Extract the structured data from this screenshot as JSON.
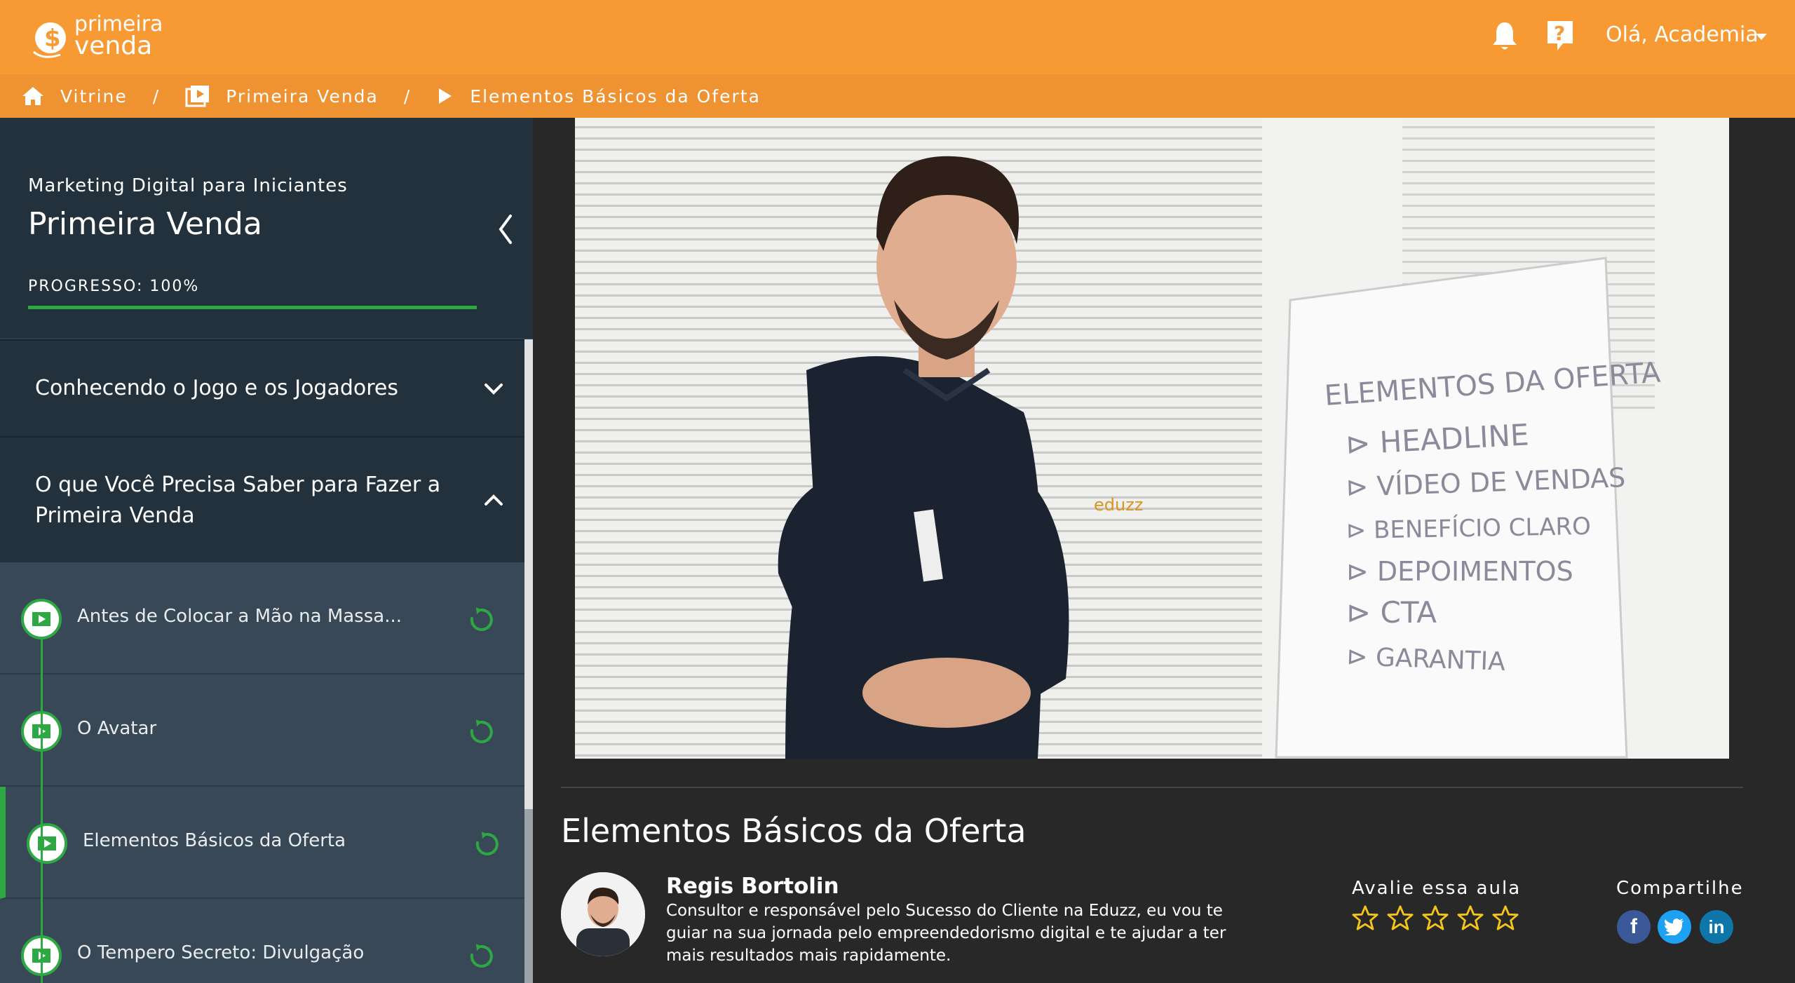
{
  "app": {
    "logo": "primeira venda",
    "logo_line1": "primeira",
    "logo_line2": "venda",
    "greeting": "Olá, Academia"
  },
  "breadcrumb": {
    "items": [
      {
        "label": "Vitrine",
        "icon": "home-icon"
      },
      {
        "label": "Primeira Venda",
        "icon": "video-library-icon"
      },
      {
        "label": "Elementos Básicos da Oferta",
        "icon": "play-icon"
      }
    ],
    "separator": "/"
  },
  "sidebar": {
    "course_subtitle": "Marketing Digital para Iniciantes",
    "course_title": "Primeira Venda",
    "progress_label": "PROGRESSO: 100%",
    "progress_value": 1.0,
    "modules": [
      {
        "title": "Conhecendo o Jogo e os Jogadores",
        "expanded": false
      },
      {
        "title_line1": "O que Você Precisa Saber para Fazer a",
        "title_line2": "Primeira Venda",
        "expanded": true
      }
    ],
    "lessons": [
      {
        "title": "Antes de Colocar a Mão na Massa...",
        "active": false
      },
      {
        "title": "O Avatar",
        "active": false
      },
      {
        "title": "Elementos Básicos da Oferta",
        "active": true
      },
      {
        "title": "O Tempero Secreto: Divulgação",
        "active": false
      }
    ]
  },
  "main": {
    "lesson_title": "Elementos Básicos da Oferta",
    "author_name": "Regis Bortolin",
    "author_bio": "Consultor e responsável pelo Sucesso do Cliente na Eduzz, eu vou te guiar na sua jornada pelo empreendedorismo digital e te ajudar a ter mais resultados mais rapidamente.",
    "rate_label": "Avalie essa aula",
    "rating": 0,
    "rating_max": 5,
    "share_label": "Compartilhe",
    "social": [
      "facebook-icon",
      "twitter-icon",
      "linkedin-icon"
    ]
  },
  "video": {
    "shirt_logo": "eduzz",
    "flipchart_title": "ELEMENTOS DA OFERTA",
    "flipchart_items": [
      "HEADLINE",
      "VÍDEO DE VENDAS",
      "BENEFÍCIO CLARO",
      "DEPOIMENTOS",
      "CTA",
      "GARANTIA"
    ]
  },
  "colors": {
    "brand_orange": "#f79a33",
    "accent_green": "#2ea843",
    "sidebar_dark": "#22313c",
    "star_gold": "#f5c518"
  }
}
